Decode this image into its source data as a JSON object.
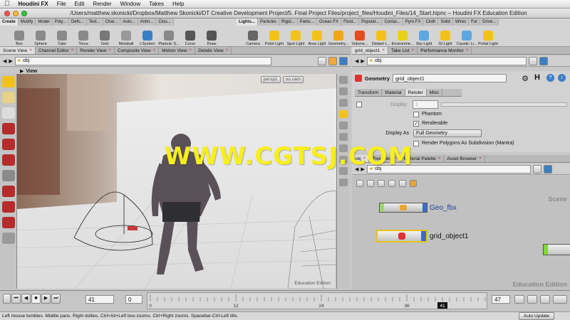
{
  "menubar": {
    "app": "Houdini FX",
    "items": [
      "File",
      "Edit",
      "Render",
      "Window",
      "Takes",
      "Help"
    ]
  },
  "window": {
    "title": "/Users/matthew.skonicki/Dropbox/Matthew Skonicki/DT Creative Development Project/5. Final Project Files/project_files/Houdini_Files/14_Start.hipnc – Houdini FX Education Edition"
  },
  "shelf_left": {
    "tabs": [
      "Create",
      "Modify",
      "Model",
      "Poly...",
      "Defo...",
      "Text...",
      "Char...",
      "Auto...",
      "Anim...",
      "Clou..."
    ],
    "tools": [
      {
        "label": "Box",
        "color": "#8a8a8a"
      },
      {
        "label": "Sphere",
        "color": "#8a8a8a"
      },
      {
        "label": "Tube",
        "color": "#8a8a8a"
      },
      {
        "label": "Torus",
        "color": "#8a8a8a"
      },
      {
        "label": "Grid",
        "color": "#777777"
      },
      {
        "label": "Metaball",
        "color": "#999999"
      },
      {
        "label": "LSystem",
        "color": "#3a7fc4"
      },
      {
        "label": "Platonic S...",
        "color": "#888888"
      },
      {
        "label": "Curve",
        "color": "#555555"
      },
      {
        "label": "Draw",
        "color": "#555555"
      }
    ]
  },
  "shelf_right": {
    "tabs": [
      "Lights...",
      "Particles",
      "Rigid...",
      "Partic...",
      "Ocean FX",
      "Fluid...",
      "Populat...",
      "Contai...",
      "Pyro FX",
      "Cloth",
      "Solid",
      "Wires",
      "Fur",
      "Drive..."
    ],
    "tools": [
      {
        "label": "Camera",
        "color": "#666666"
      },
      {
        "label": "Point Light",
        "color": "#f2c21b"
      },
      {
        "label": "Spot Light",
        "color": "#f2c21b"
      },
      {
        "label": "Area Light",
        "color": "#f2c21b"
      },
      {
        "label": "Geometry...",
        "color": "#f2a51b"
      },
      {
        "label": "Volume...",
        "color": "#e84a1b"
      },
      {
        "label": "Distant L...",
        "color": "#f2c21b"
      },
      {
        "label": "Environme...",
        "color": "#e8d01b"
      },
      {
        "label": "Sky Light",
        "color": "#5fa7e0"
      },
      {
        "label": "GI Light",
        "color": "#f2c21b"
      },
      {
        "label": "Caustic Li...",
        "color": "#5fa7e0"
      },
      {
        "label": "Portal Light",
        "color": "#f2c21b"
      }
    ]
  },
  "left_pane_tabs": [
    {
      "label": "Scene View",
      "active": true
    },
    {
      "label": "Channel Editor",
      "active": false
    },
    {
      "label": "Render View",
      "active": false
    },
    {
      "label": "Composite View",
      "active": false
    },
    {
      "label": "Motion View",
      "active": false
    },
    {
      "label": "Details View",
      "active": false
    }
  ],
  "left_path": "obj",
  "viewport": {
    "label": "View",
    "persp_menu": "persp1",
    "cam_menu": "no cam",
    "edition_label": "Education Edition"
  },
  "right_pane_tabs": [
    {
      "label": "grid_object1",
      "active": true
    },
    {
      "label": "Take List",
      "active": false
    },
    {
      "label": "Performance Monitor",
      "active": false
    }
  ],
  "params": {
    "type_label": "Geometry",
    "node_name": "grid_object1",
    "tabs": [
      {
        "label": "Transform",
        "active": false
      },
      {
        "label": "Material",
        "active": false
      },
      {
        "label": "Render",
        "active": true
      },
      {
        "label": "Misc",
        "active": false
      }
    ],
    "display_label": "Display",
    "display_value": "1",
    "phantom_label": "Phantom",
    "renderable_label": "Renderable",
    "display_as_label": "Display As",
    "display_as_value": "Full Geometry",
    "subdivision_label": "Render Polygons As Subdivision (Mantra)"
  },
  "network_tabs": [
    {
      "label": "obj",
      "active": true
    },
    {
      "label": "Tree View",
      "active": false
    },
    {
      "label": "Material Palette",
      "active": false
    },
    {
      "label": "Asset Browser",
      "active": false
    }
  ],
  "network_path": "obj",
  "network": {
    "scene_label": "Scene",
    "edition_label": "Education Edition",
    "nodes": [
      {
        "name": "Geo_fbx",
        "selected": false
      },
      {
        "name": "grid_object1",
        "selected": true
      }
    ]
  },
  "timeline": {
    "current_frame": "41",
    "start_frame": "0",
    "end_frame": "47",
    "ticks": [
      "0",
      "12",
      "24",
      "36",
      "41"
    ],
    "update_mode": "Auto Update"
  },
  "status": "Left mouse tumbles. Middle pans. Right dollies. Ctrl+Alt+Left box-zooms. Ctrl+Right zooms. Spacebar-Ctrl-Left tilts.",
  "watermark": "WWW.CGTSJ.COM",
  "icons": [
    "apple-icon",
    "back-arrow-icon",
    "forward-arrow-icon",
    "obj-icon",
    "gear-icon",
    "help-icon",
    "info-icon",
    "houdini-h-icon",
    "play-icon",
    "stop-icon"
  ]
}
